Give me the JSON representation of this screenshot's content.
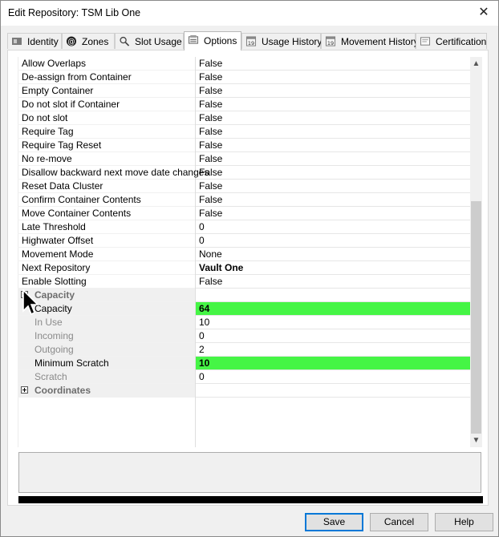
{
  "window": {
    "title": "Edit Repository: TSM Lib One",
    "close_glyph": "✕"
  },
  "tabs": [
    {
      "label": "Identity",
      "icon": "identity-icon"
    },
    {
      "label": "Zones",
      "icon": "at-sign-icon"
    },
    {
      "label": "Slot Usage",
      "icon": "magnifier-icon"
    },
    {
      "label": "Options",
      "icon": "options-icon",
      "active": true
    },
    {
      "label": "Usage History",
      "icon": "calendar-icon"
    },
    {
      "label": "Movement History",
      "icon": "calendar-icon"
    },
    {
      "label": "Certification",
      "icon": "certificate-icon"
    }
  ],
  "properties": [
    {
      "name": "Allow Overlaps",
      "value": "False"
    },
    {
      "name": "De-assign from Container",
      "value": "False"
    },
    {
      "name": "Empty Container",
      "value": "False"
    },
    {
      "name": "Do not slot if Container",
      "value": "False"
    },
    {
      "name": "Do not slot",
      "value": "False"
    },
    {
      "name": "Require Tag",
      "value": "False"
    },
    {
      "name": "Require Tag Reset",
      "value": "False"
    },
    {
      "name": "No re-move",
      "value": "False"
    },
    {
      "name": "Disallow backward next move date changes",
      "value": "False"
    },
    {
      "name": "Reset Data Cluster",
      "value": "False"
    },
    {
      "name": "Confirm Container Contents",
      "value": "False"
    },
    {
      "name": "Move Container Contents",
      "value": "False"
    },
    {
      "name": "Late Threshold",
      "value": "0"
    },
    {
      "name": "Highwater Offset",
      "value": "0"
    },
    {
      "name": "Movement Mode",
      "value": "None"
    },
    {
      "name": "Next Repository",
      "value": "Vault One",
      "bold": true
    },
    {
      "name": "Enable Slotting",
      "value": "False"
    }
  ],
  "capacity_group": {
    "label": "Capacity",
    "items": [
      {
        "name": "Capacity",
        "value": "64",
        "highlight": true,
        "dim": false
      },
      {
        "name": "In Use",
        "value": "10",
        "highlight": false,
        "dim": true
      },
      {
        "name": "Incoming",
        "value": "0",
        "highlight": false,
        "dim": true
      },
      {
        "name": "Outgoing",
        "value": "2",
        "highlight": false,
        "dim": true
      },
      {
        "name": "Minimum Scratch",
        "value": "10",
        "highlight": true,
        "dim": false
      },
      {
        "name": "Scratch",
        "value": "0",
        "highlight": false,
        "dim": true
      }
    ]
  },
  "coordinates_group": {
    "label": "Coordinates"
  },
  "colors": {
    "highlight": "#45f545",
    "default_button_border": "#0078d7"
  },
  "buttons": {
    "save": "Save",
    "cancel": "Cancel",
    "help": "Help"
  }
}
